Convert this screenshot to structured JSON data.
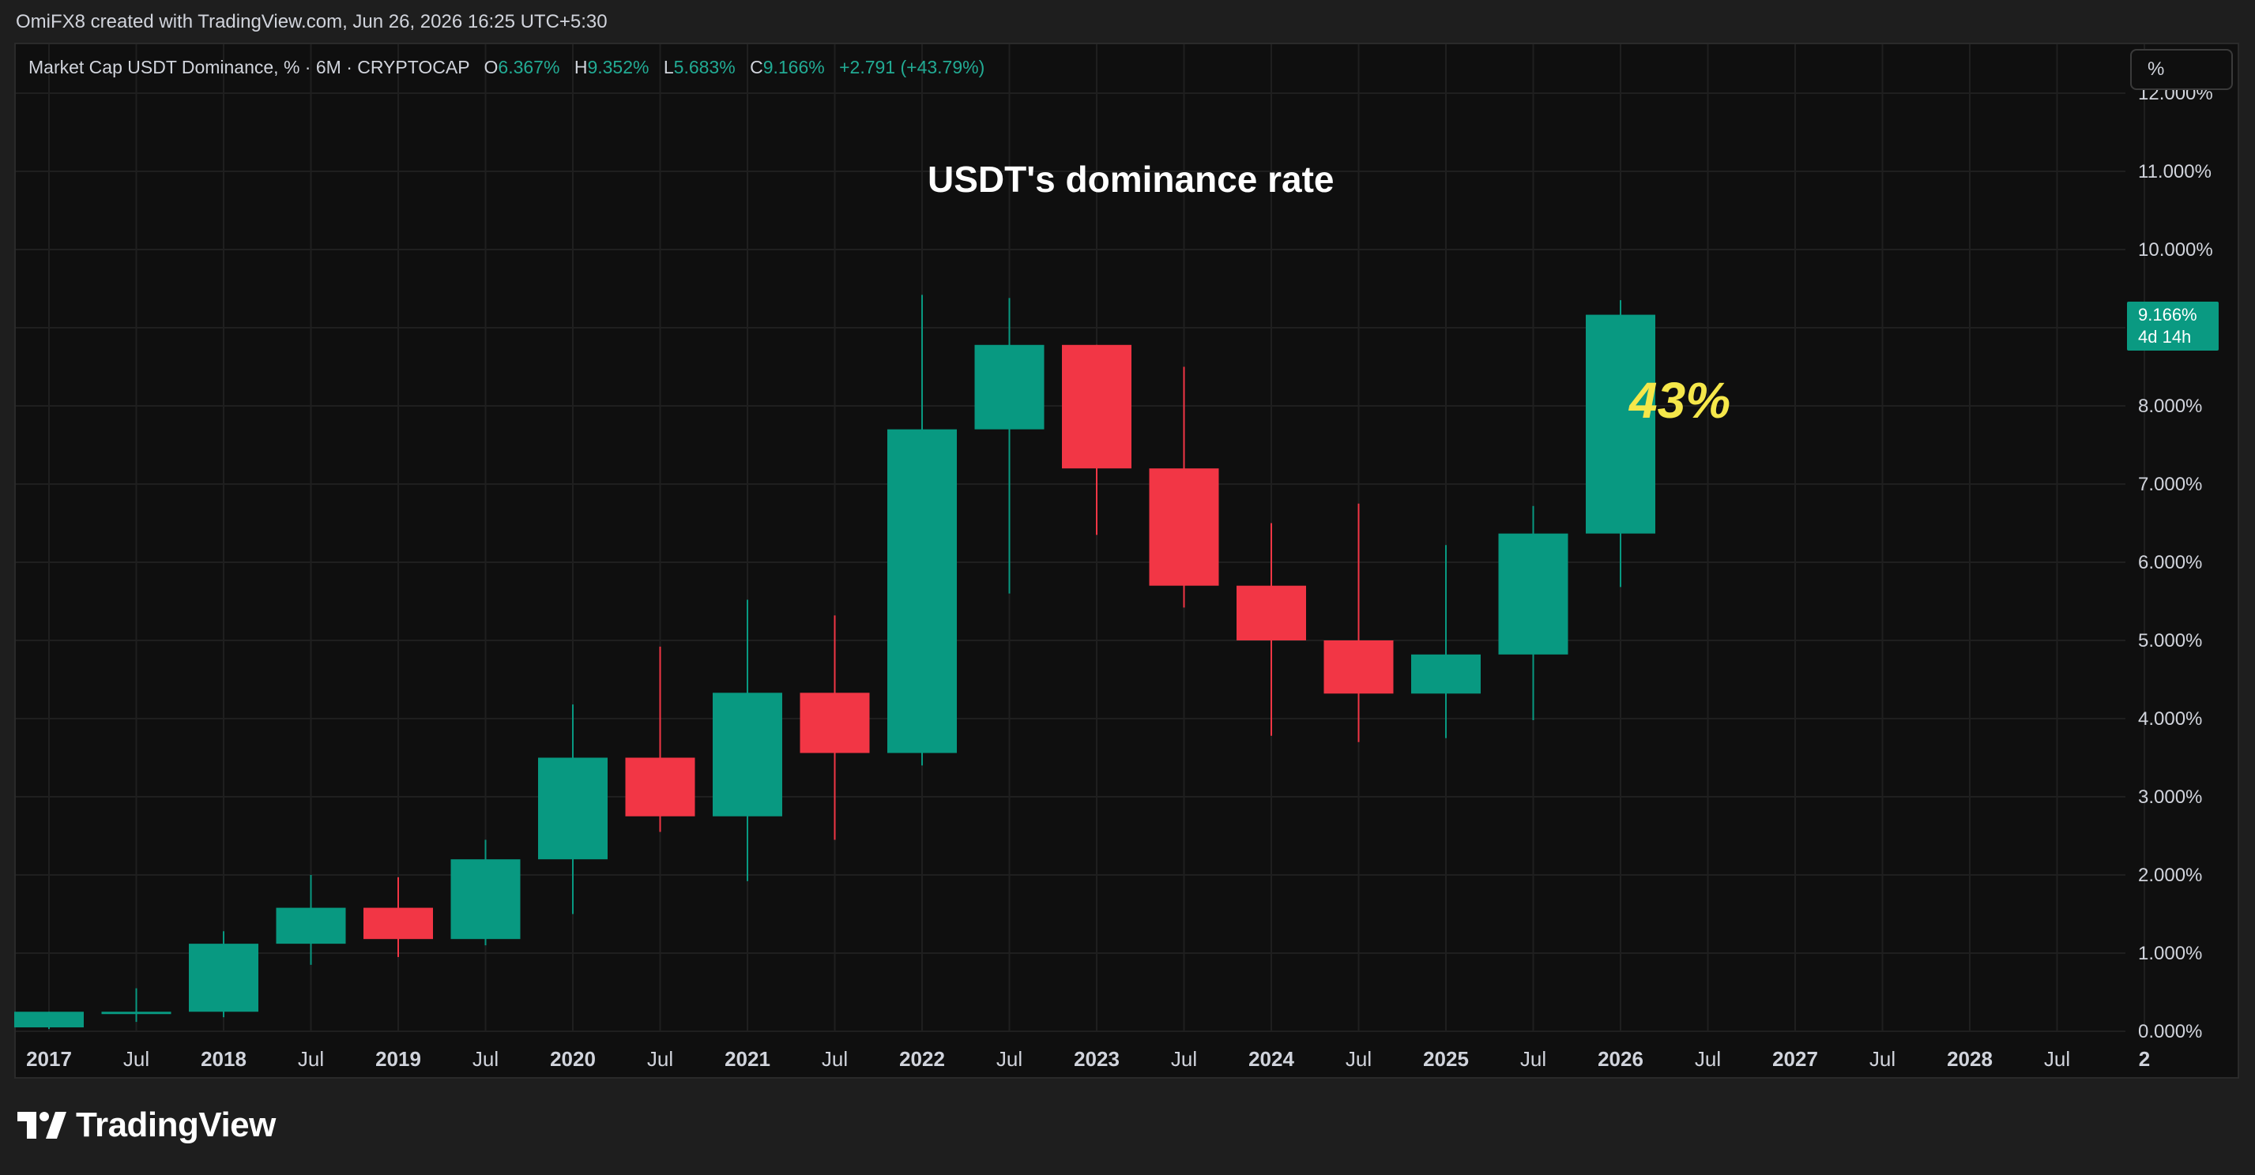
{
  "header": {
    "attribution": "OmiFX8 created with TradingView.com, Jun 26, 2026 16:25 UTC+5:30"
  },
  "legend": {
    "symbol": "Market Cap USDT Dominance, % · 6M · CRYPTOCAP",
    "o_label": "O",
    "o_value": "6.367%",
    "h_label": "H",
    "h_value": "9.352%",
    "l_label": "L",
    "l_value": "5.683%",
    "c_label": "C",
    "c_value": "9.166%",
    "change": "+2.791 (+43.79%)"
  },
  "scale_button": {
    "label": "%"
  },
  "price_badge": {
    "price": "9.166%",
    "countdown": "4d 14h"
  },
  "footer": {
    "brand": "TradingView"
  },
  "chart_data": {
    "type": "candlestick",
    "title": "USDT's dominance rate",
    "annotation": "43%",
    "xlabel": "",
    "ylabel": "",
    "ylim": [
      0,
      12
    ],
    "grid": true,
    "y_ticks": [
      "0.000%",
      "1.000%",
      "2.000%",
      "3.000%",
      "4.000%",
      "5.000%",
      "6.000%",
      "7.000%",
      "8.000%",
      "9.000%",
      "10.000%",
      "11.000%",
      "12.000%"
    ],
    "x_ticks": [
      {
        "label": "2017",
        "i": 0,
        "bold": true
      },
      {
        "label": "Jul",
        "i": 1,
        "bold": false
      },
      {
        "label": "2018",
        "i": 2,
        "bold": true
      },
      {
        "label": "Jul",
        "i": 3,
        "bold": false
      },
      {
        "label": "2019",
        "i": 4,
        "bold": true
      },
      {
        "label": "Jul",
        "i": 5,
        "bold": false
      },
      {
        "label": "2020",
        "i": 6,
        "bold": true
      },
      {
        "label": "Jul",
        "i": 7,
        "bold": false
      },
      {
        "label": "2021",
        "i": 8,
        "bold": true
      },
      {
        "label": "Jul",
        "i": 9,
        "bold": false
      },
      {
        "label": "2022",
        "i": 10,
        "bold": true
      },
      {
        "label": "Jul",
        "i": 11,
        "bold": false
      },
      {
        "label": "2023",
        "i": 12,
        "bold": true
      },
      {
        "label": "Jul",
        "i": 13,
        "bold": false
      },
      {
        "label": "2024",
        "i": 14,
        "bold": true
      },
      {
        "label": "Jul",
        "i": 15,
        "bold": false
      },
      {
        "label": "2025",
        "i": 16,
        "bold": true
      },
      {
        "label": "Jul",
        "i": 17,
        "bold": false
      },
      {
        "label": "2026",
        "i": 18,
        "bold": true
      },
      {
        "label": "Jul",
        "i": 19,
        "bold": false
      },
      {
        "label": "2027",
        "i": 20,
        "bold": true
      },
      {
        "label": "Jul",
        "i": 21,
        "bold": false
      },
      {
        "label": "2028",
        "i": 22,
        "bold": true
      },
      {
        "label": "Jul",
        "i": 23,
        "bold": false
      },
      {
        "label": "2",
        "i": 24,
        "bold": true
      }
    ],
    "candles": [
      {
        "period": "2017 H1",
        "open": 0.05,
        "high": 0.25,
        "low": 0.03,
        "close": 0.25
      },
      {
        "period": "2017 H2",
        "open": 0.22,
        "high": 0.55,
        "low": 0.12,
        "close": 0.25
      },
      {
        "period": "2018 H1",
        "open": 0.25,
        "high": 1.28,
        "low": 0.18,
        "close": 1.12
      },
      {
        "period": "2018 H2",
        "open": 1.12,
        "high": 2.0,
        "low": 0.85,
        "close": 1.58
      },
      {
        "period": "2019 H1",
        "open": 1.58,
        "high": 1.97,
        "low": 0.95,
        "close": 1.18
      },
      {
        "period": "2019 H2",
        "open": 1.18,
        "high": 2.45,
        "low": 1.1,
        "close": 2.2
      },
      {
        "period": "2020 H1",
        "open": 2.2,
        "high": 4.18,
        "low": 1.5,
        "close": 3.5
      },
      {
        "period": "2020 H2",
        "open": 3.5,
        "high": 4.92,
        "low": 2.55,
        "close": 2.75
      },
      {
        "period": "2021 H1",
        "open": 2.75,
        "high": 5.52,
        "low": 1.92,
        "close": 4.33
      },
      {
        "period": "2021 H2",
        "open": 4.33,
        "high": 5.32,
        "low": 2.45,
        "close": 3.56
      },
      {
        "period": "2022 H1",
        "open": 3.56,
        "high": 9.42,
        "low": 3.4,
        "close": 7.7
      },
      {
        "period": "2022 H2",
        "open": 7.7,
        "high": 9.38,
        "low": 5.6,
        "close": 8.78
      },
      {
        "period": "2023 H1",
        "open": 8.78,
        "high": 8.78,
        "low": 6.35,
        "close": 7.2
      },
      {
        "period": "2023 H2",
        "open": 7.2,
        "high": 8.5,
        "low": 5.42,
        "close": 5.7
      },
      {
        "period": "2024 H1",
        "open": 5.7,
        "high": 6.5,
        "low": 3.78,
        "close": 5.0
      },
      {
        "period": "2024 H2",
        "open": 5.0,
        "high": 6.75,
        "low": 3.7,
        "close": 4.32
      },
      {
        "period": "2025 H1",
        "open": 4.32,
        "high": 6.22,
        "low": 3.75,
        "close": 4.82
      },
      {
        "period": "2025 H2",
        "open": 4.82,
        "high": 6.72,
        "low": 3.98,
        "close": 6.367
      },
      {
        "period": "2026 H1",
        "open": 6.367,
        "high": 9.352,
        "low": 5.683,
        "close": 9.166
      }
    ],
    "colors": {
      "up": "#089981",
      "down": "#f23645",
      "grid": "#1f1f1f",
      "axis_text": "#d1d4dc"
    }
  }
}
